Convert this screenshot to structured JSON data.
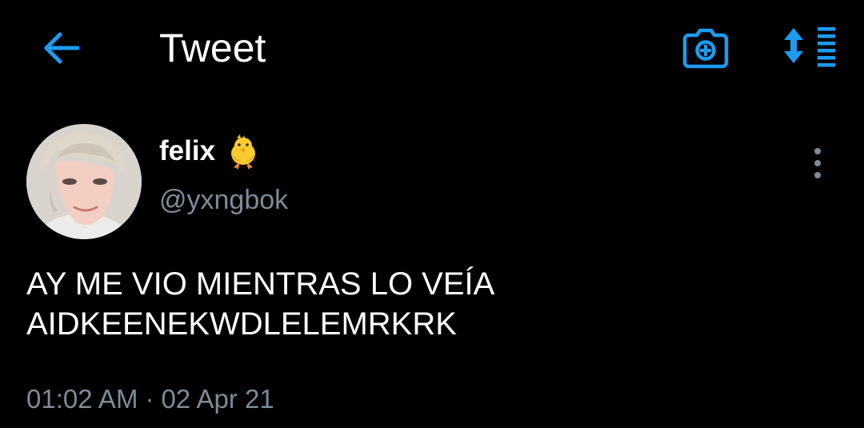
{
  "header": {
    "title": "Tweet",
    "back_icon": "arrow-left-icon",
    "camera_icon": "camera-plus-icon",
    "sort_icon": "sort-list-icon"
  },
  "tweet": {
    "author": {
      "display_name": "felix",
      "emoji": "🐤",
      "handle": "@yxngbok"
    },
    "text_lines": [
      "AY ME VIO MIENTRAS LO VEÍA",
      "AIDKEENEKWDLELEMRKRK"
    ],
    "time": "01:02 AM",
    "separator": "·",
    "date": "02 Apr 21",
    "more_icon": "more-vertical-icon"
  },
  "colors": {
    "background": "#000000",
    "accent": "#1d9bf0",
    "primary_text": "#ffffff",
    "secondary_text": "#7e8b98"
  }
}
